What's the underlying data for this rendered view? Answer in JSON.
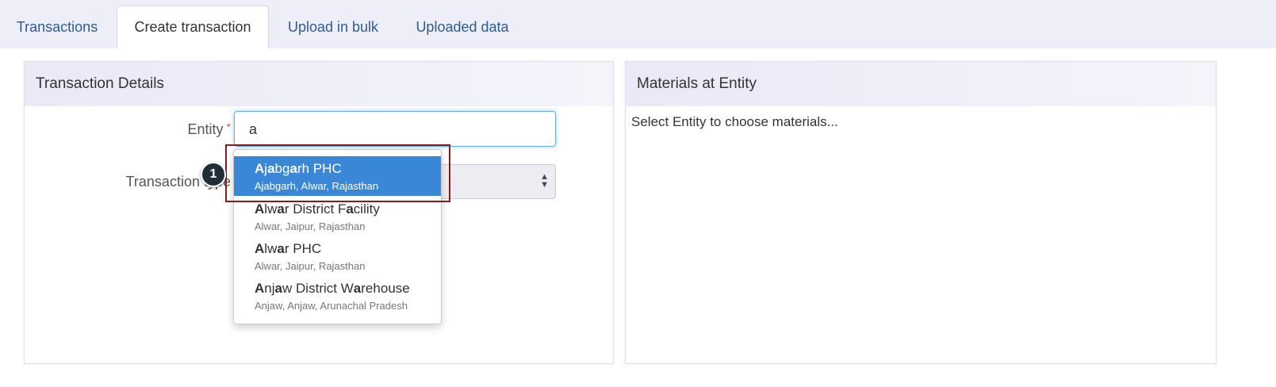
{
  "tabs": [
    {
      "label": "Transactions"
    },
    {
      "label": "Create transaction"
    },
    {
      "label": "Upload in bulk"
    },
    {
      "label": "Uploaded data"
    }
  ],
  "active_tab": "Create transaction",
  "transaction_panel": {
    "title": "Transaction Details",
    "entity_label": "Entity",
    "required_marker": "*",
    "entity_value": "a",
    "transaction_type_label": "Transaction type"
  },
  "dropdown": {
    "typed": "a",
    "items": [
      {
        "name": "Ajabgarh PHC",
        "location": "Ajabgarh, Alwar, Rajasthan",
        "highlighted": true
      },
      {
        "name": "Alwar District Facility",
        "location": "Alwar, Jaipur, Rajasthan",
        "highlighted": false
      },
      {
        "name": "Alwar PHC",
        "location": "Alwar, Jaipur, Rajasthan",
        "highlighted": false
      },
      {
        "name": "Anjaw District Warehouse",
        "location": "Anjaw, Anjaw, Arunachal Pradesh",
        "highlighted": false
      }
    ]
  },
  "annotation": {
    "step": "1"
  },
  "materials_panel": {
    "title": "Materials at Entity",
    "message": "Select Entity to choose materials..."
  },
  "colors": {
    "accent": "#3a87d8",
    "link": "#2b5c97",
    "highlight_border": "#8c1a1a"
  }
}
